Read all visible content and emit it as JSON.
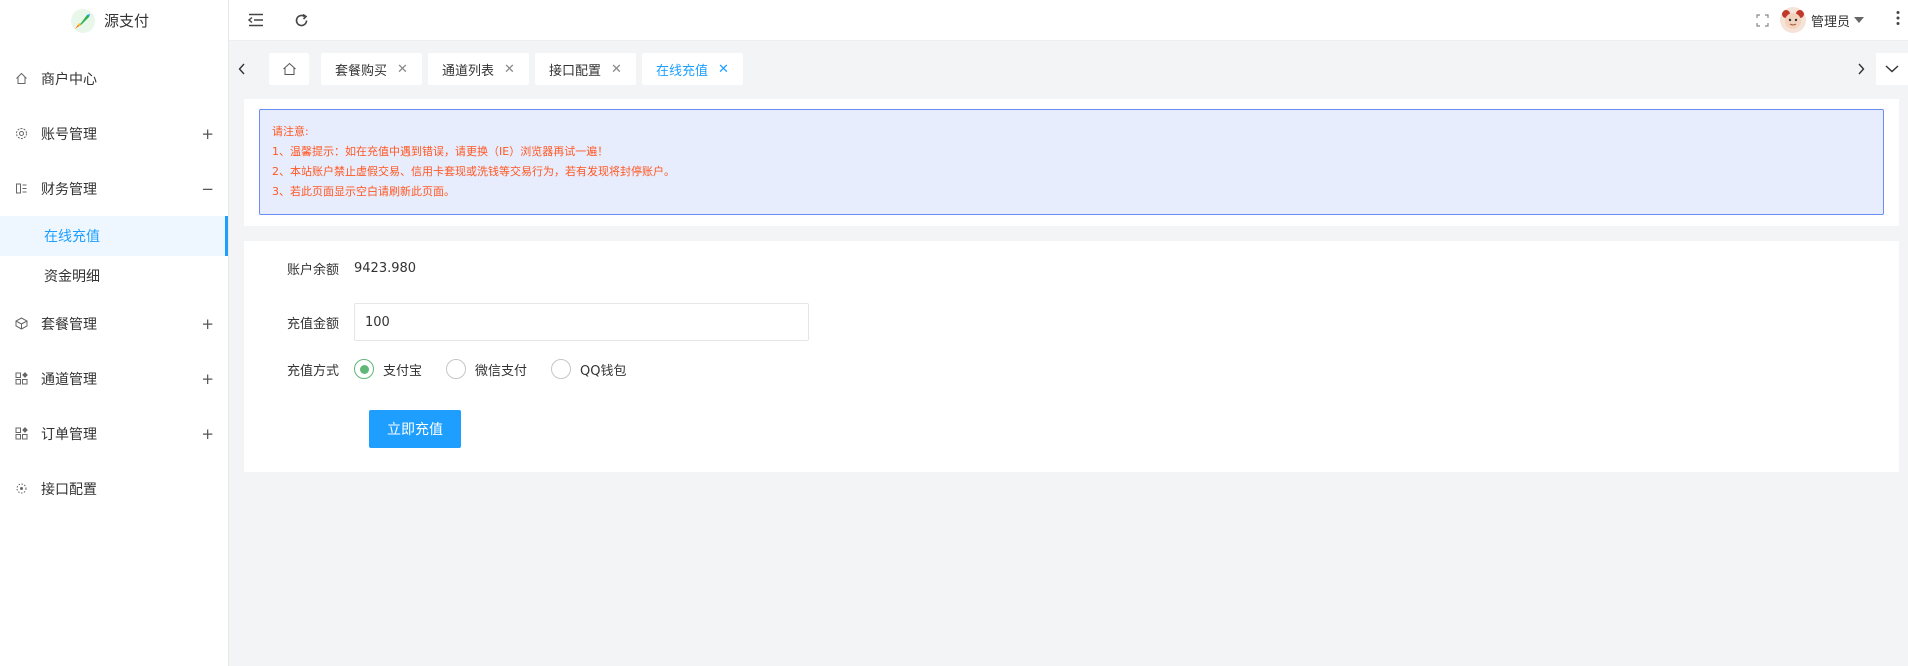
{
  "app": {
    "name": "源支付"
  },
  "sidebar": {
    "items": [
      {
        "label": "商户中心",
        "icon": "home-icon"
      },
      {
        "label": "账号管理",
        "icon": "gear-icon",
        "toggle": "+"
      },
      {
        "label": "财务管理",
        "icon": "finance-icon",
        "toggle": "−"
      },
      {
        "label": "套餐管理",
        "icon": "package-icon",
        "toggle": "+"
      },
      {
        "label": "通道管理",
        "icon": "grid-icon",
        "toggle": "+"
      },
      {
        "label": "订单管理",
        "icon": "grid-icon",
        "toggle": "+"
      },
      {
        "label": "接口配置",
        "icon": "api-icon"
      }
    ],
    "finance_sub": [
      {
        "label": "在线充值",
        "active": true
      },
      {
        "label": "资金明细",
        "active": false
      }
    ]
  },
  "header": {
    "user_name": "管理员"
  },
  "tabs": [
    {
      "label": "套餐购买"
    },
    {
      "label": "通道列表"
    },
    {
      "label": "接口配置"
    },
    {
      "label": "在线充值",
      "active": true
    }
  ],
  "notice": {
    "title": "请注意:",
    "lines": [
      "1、温馨提示：如在充值中遇到错误，请更换（IE）浏览器再试一遍！",
      "2、本站账户禁止虚假交易、信用卡套现或洗钱等交易行为，若有发现将封停账户。",
      "3、若此页面显示空白请刷新此页面。"
    ]
  },
  "form": {
    "balance_label": "账户余额",
    "balance_value": "9423.980",
    "amount_label": "充值金额",
    "amount_value": "100",
    "method_label": "充值方式",
    "methods": [
      {
        "label": "支付宝",
        "checked": true
      },
      {
        "label": "微信支付",
        "checked": false
      },
      {
        "label": "QQ钱包",
        "checked": false
      }
    ],
    "submit_label": "立即充值"
  },
  "colors": {
    "accent": "#1e9fff",
    "notice_text": "#ff5722",
    "notice_bg": "#e8edfd",
    "radio_checked": "#5fb878"
  }
}
